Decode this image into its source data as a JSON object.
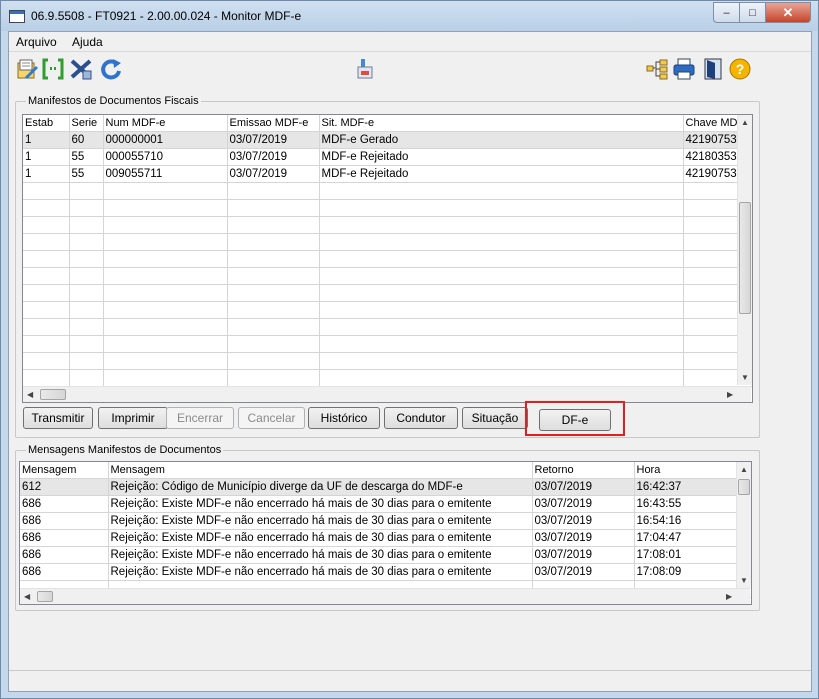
{
  "window": {
    "title": "06.9.5508 - FT0921 - 2.00.00.024 - Monitor MDF-e",
    "minimize": "–",
    "maximize": "□",
    "close": "✕"
  },
  "menu": [
    "Arquivo",
    "Ajuda"
  ],
  "toolbar_icons": [
    "edit-document-icon",
    "bracket-icon",
    "cancel-x-icon",
    "refresh-icon",
    "transmit-icon",
    "tree-icon",
    "print-icon",
    "exit-door-icon",
    "help-icon"
  ],
  "manifestos": {
    "legend": "Manifestos de Documentos Fiscais",
    "columns": [
      "Estab",
      "Serie",
      "Num MDF-e",
      "Emissao MDF-e",
      "Sit. MDF-e",
      "Chave MDF"
    ],
    "rows": [
      [
        "1",
        "60",
        "000000001",
        "03/07/2019",
        "MDF-e Gerado",
        "42190753"
      ],
      [
        "1",
        "55",
        "000055710",
        "03/07/2019",
        "MDF-e Rejeitado",
        "42180353"
      ],
      [
        "1",
        "55",
        "009055711",
        "03/07/2019",
        "MDF-e Rejeitado",
        "42190753"
      ]
    ]
  },
  "buttons": {
    "transmitir": "Transmitir",
    "imprimir": "Imprimir",
    "encerrar": "Encerrar",
    "cancelar": "Cancelar",
    "historico": "Histórico",
    "condutor": "Condutor",
    "situacao": "Situação",
    "dfe": "DF-e"
  },
  "mensagens": {
    "legend": "Mensagens Manifestos de Documentos",
    "columns": [
      "Mensagem",
      "Mensagem",
      "Retorno",
      "Hora"
    ],
    "rows": [
      [
        "612",
        "Rejeição: Código de Município diverge da UF de descarga do MDF-e",
        "03/07/2019",
        "16:42:37"
      ],
      [
        "686",
        "Rejeição: Existe MDF-e não encerrado há mais de 30 dias para o emitente",
        "03/07/2019",
        "16:43:55"
      ],
      [
        "686",
        "Rejeição: Existe MDF-e não encerrado há mais de 30 dias para o emitente",
        "03/07/2019",
        "16:54:16"
      ],
      [
        "686",
        "Rejeição: Existe MDF-e não encerrado há mais de 30 dias para o emitente",
        "03/07/2019",
        "17:04:47"
      ],
      [
        "686",
        "Rejeição: Existe MDF-e não encerrado há mais de 30 dias para o emitente",
        "03/07/2019",
        "17:08:01"
      ],
      [
        "686",
        "Rejeição: Existe MDF-e não encerrado há mais de 30 dias para o emitente",
        "03/07/2019",
        "17:08:09"
      ]
    ]
  }
}
